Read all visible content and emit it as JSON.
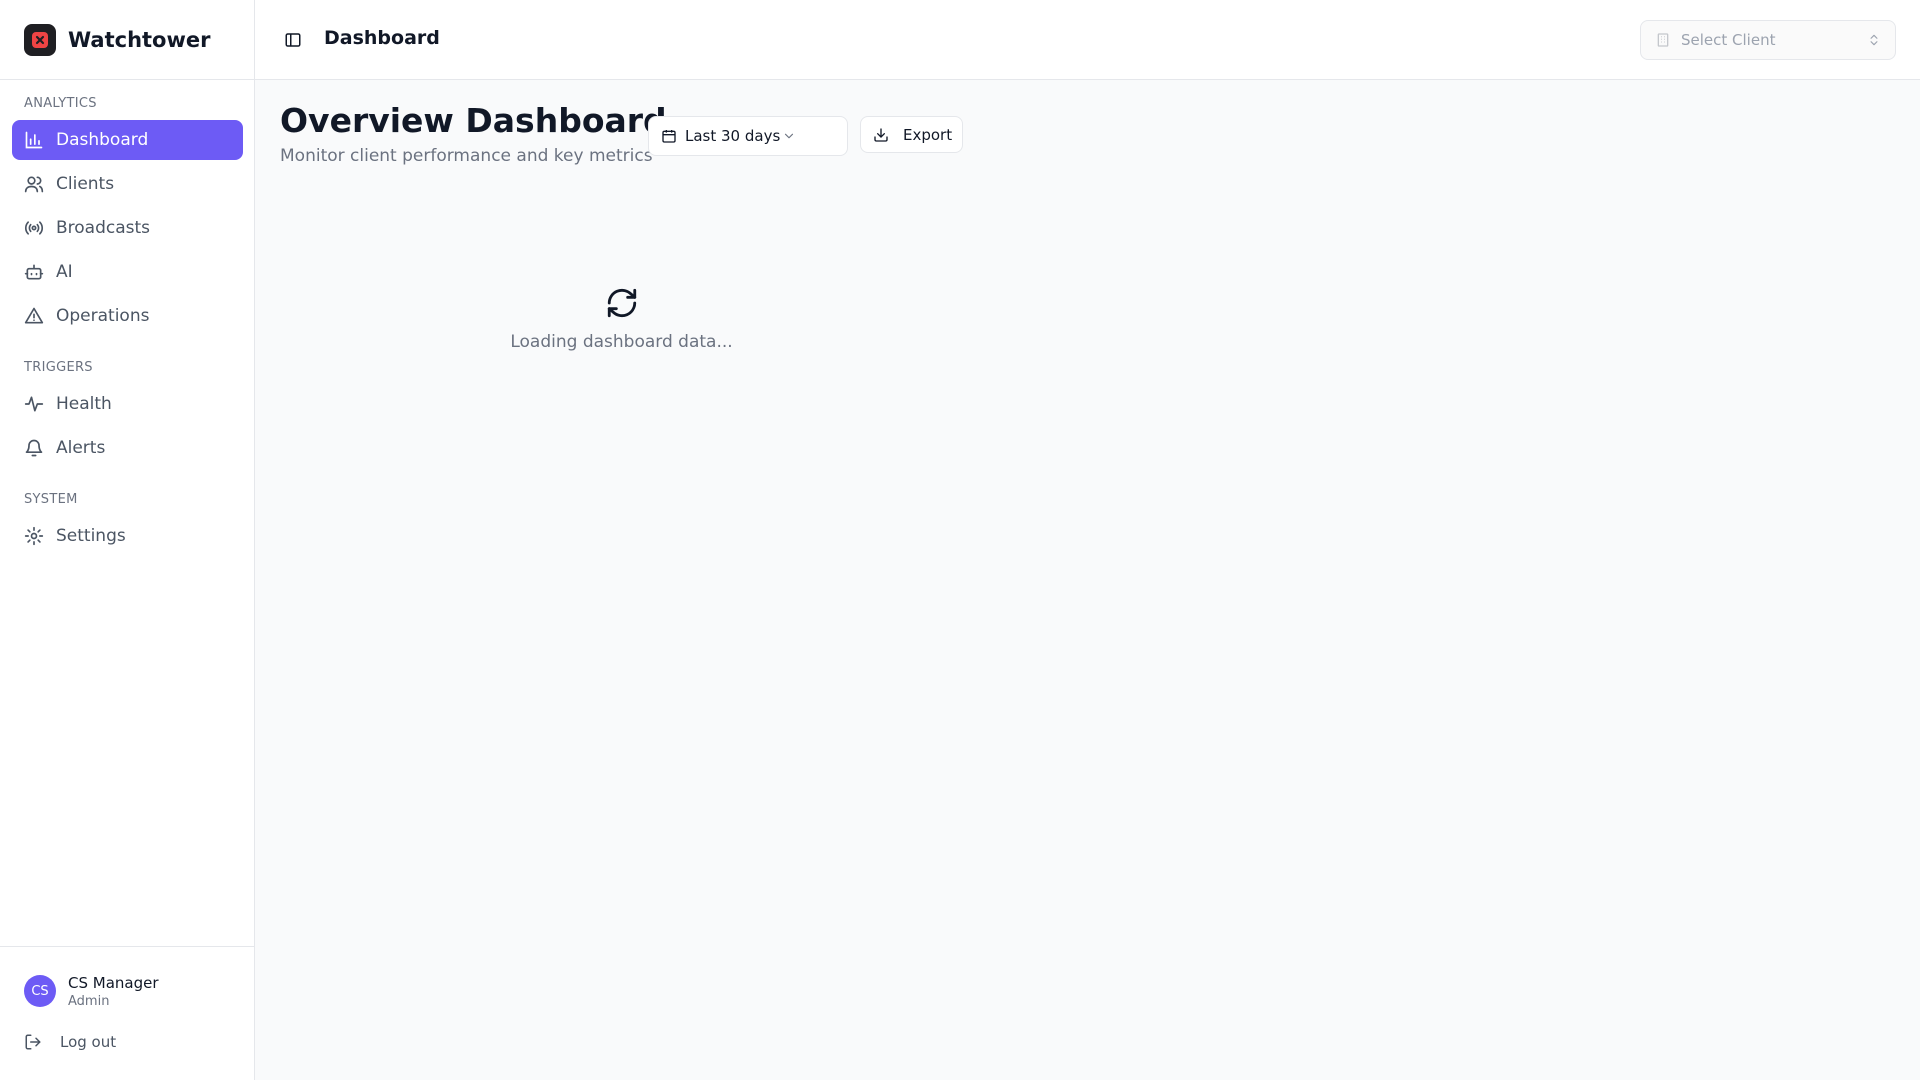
{
  "app": {
    "name": "Watchtower",
    "logo_icon": "watchtower-logo-icon"
  },
  "colors": {
    "accent": "#6d5bf5",
    "logo_bg": "#1f1f23",
    "logo_mark": "#ef4444"
  },
  "sidebar": {
    "sections": [
      {
        "label": "ANALYTICS",
        "items": [
          {
            "label": "Dashboard",
            "icon": "bar-chart-icon",
            "active": true
          },
          {
            "label": "Clients",
            "icon": "users-icon"
          },
          {
            "label": "Broadcasts",
            "icon": "radio-icon"
          },
          {
            "label": "AI",
            "icon": "bot-icon"
          },
          {
            "label": "Operations",
            "icon": "warning-triangle-icon"
          }
        ]
      },
      {
        "label": "TRIGGERS",
        "items": [
          {
            "label": "Health",
            "icon": "activity-icon"
          },
          {
            "label": "Alerts",
            "icon": "bell-icon"
          }
        ]
      },
      {
        "label": "SYSTEM",
        "items": [
          {
            "label": "Settings",
            "icon": "gear-icon"
          }
        ]
      }
    ],
    "user": {
      "initials": "CS",
      "name": "CS Manager",
      "role": "Admin"
    },
    "logout_label": "Log out"
  },
  "header": {
    "breadcrumb": "Dashboard",
    "client_select_placeholder": "Select Client"
  },
  "main": {
    "title": "Overview Dashboard",
    "subtitle": "Monitor client performance and key metrics",
    "date_range": "Last 30 days",
    "export_label": "Export",
    "loading_text": "Loading dashboard data..."
  }
}
